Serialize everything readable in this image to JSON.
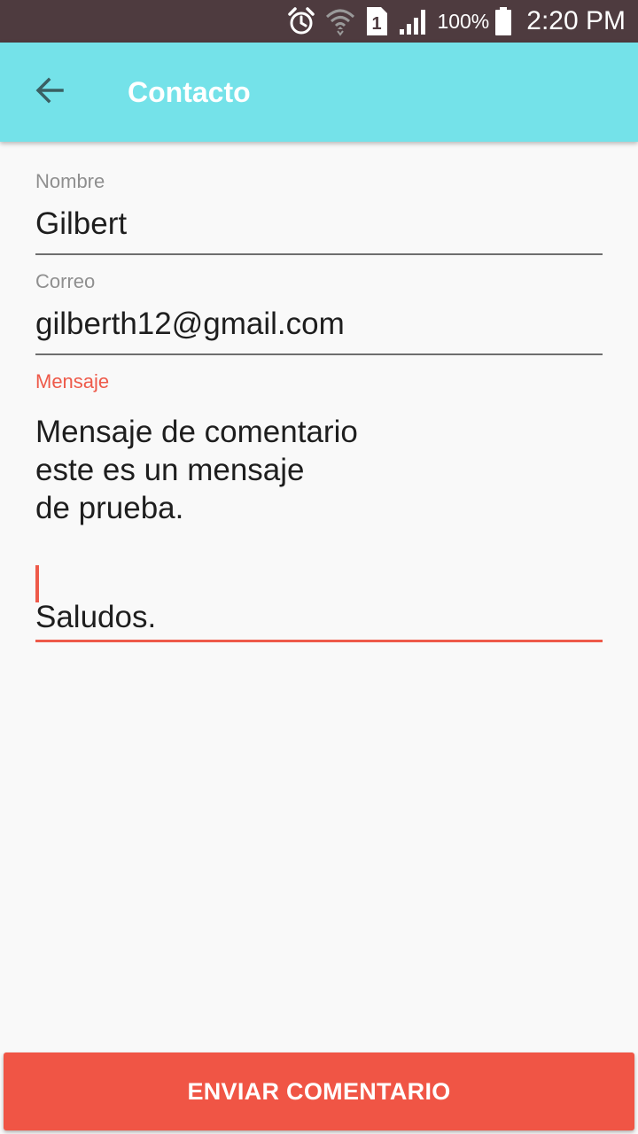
{
  "status_bar": {
    "battery_percent": "100%",
    "time": "2:20 PM",
    "sim_slot": "1",
    "icons": [
      "alarm-icon",
      "wifi-icon",
      "sim-icon",
      "signal-icon",
      "battery-icon"
    ]
  },
  "app_bar": {
    "title": "Contacto",
    "back_icon": "arrow-left-icon",
    "background_color": "#74e2e9"
  },
  "form": {
    "name": {
      "label": "Nombre",
      "value": "Gilbert"
    },
    "email": {
      "label": "Correo",
      "value": "gilberth12@gmail.com"
    },
    "message": {
      "label": "Mensaje",
      "lines": [
        "Mensaje de comentario",
        "este es un mensaje",
        "de prueba.",
        "",
        "Saludos."
      ],
      "focused": true
    }
  },
  "submit": {
    "label": "ENVIAR COMENTARIO",
    "color": "#f05545"
  },
  "colors": {
    "accent": "#ee5a4a",
    "status_bar": "#4e3b3f"
  }
}
